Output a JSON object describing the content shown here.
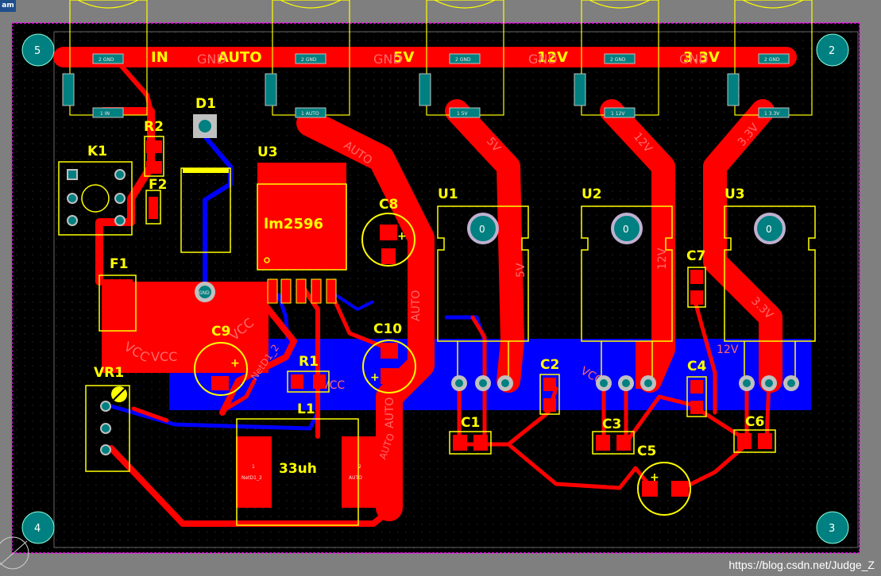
{
  "tab": {
    "label": "am"
  },
  "watermark": "https://blog.csdn.net/Judge_Z",
  "mounting_holes": [
    "5",
    "2",
    "4",
    "3"
  ],
  "header": {
    "labels": [
      "IN",
      "AUTO",
      "5V",
      "12V",
      "3.3V"
    ],
    "gnd_label": "GND"
  },
  "terminals": {
    "top_pads": [
      "2 GND",
      "2 GND",
      "2 GND",
      "2 GND",
      "2 GND"
    ],
    "bottom_pads": [
      "1 IN",
      "1 AUTO",
      "1 5V",
      "1 12V",
      "1 3.3V"
    ]
  },
  "refdes": {
    "D1": "D1",
    "R2": "R2",
    "K1": "K1",
    "F2": "F2",
    "F1": "F1",
    "U3_main": "U3",
    "lm2596": "lm2596",
    "C8": "C8",
    "C9": "C9",
    "C10": "C10",
    "R1": "R1",
    "L1": "L1",
    "inductor_value": "33uh",
    "VR1": "VR1",
    "U1": "U1",
    "U2": "U2",
    "U3_reg": "U3",
    "C7": "C7",
    "C2": "C2",
    "C1": "C1",
    "C3": "C3",
    "C4": "C4",
    "C5": "C5",
    "C6": "C6"
  },
  "nets": {
    "auto": "AUTO",
    "v5": "5V",
    "v12": "12V",
    "v33": "3.3V",
    "vcc": "VCC",
    "netd1_2": "NetD1_2",
    "l1_pad1": "1",
    "l1_pad2": "2",
    "gnd": "GND",
    "reg_hole": "0"
  },
  "colors": {
    "board": "#000000",
    "outline": "#ff00ff",
    "top_copper": "#ff0000",
    "bottom_copper": "#0000ff",
    "silkscreen": "#ffff00",
    "pad": "#c0c0c0",
    "hole": "#008080"
  }
}
